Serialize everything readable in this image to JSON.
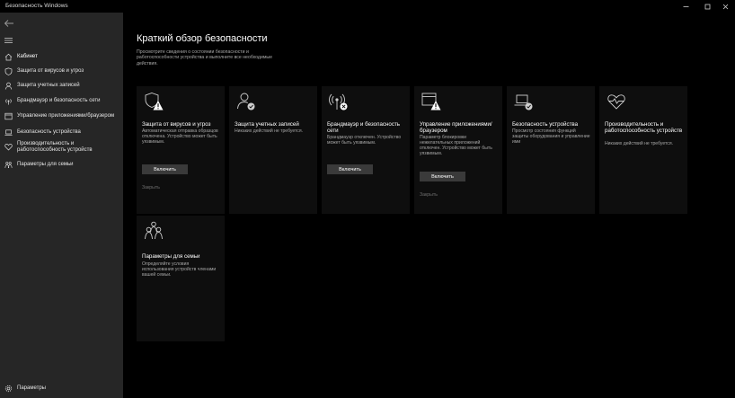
{
  "window": {
    "title": "Безопасность Windows"
  },
  "sidebar": {
    "items": [
      {
        "label": "Кабинет",
        "icon": "home-icon"
      },
      {
        "label": "Защита от вирусов и угроз",
        "icon": "shield-icon"
      },
      {
        "label": "Защита учетных записей",
        "icon": "person-icon"
      },
      {
        "label": "Брандмауэр и безопасность сети",
        "icon": "network-icon"
      },
      {
        "label": "Управление приложениями/браузером",
        "icon": "browser-icon"
      },
      {
        "label": "Безопасность устройства",
        "icon": "laptop-icon"
      },
      {
        "label": "Производительность и работоспособность устройств",
        "icon": "heart-icon"
      },
      {
        "label": "Параметры для семьи",
        "icon": "family-icon"
      }
    ],
    "settings_label": "Параметры"
  },
  "main": {
    "title": "Краткий обзор безопасности",
    "description": "Просмотрите сведения о состоянии безопасности и работоспособности устройства и выполните все необходимые действия."
  },
  "cards": [
    {
      "title": "Защита от вирусов и угроз",
      "description": "Автоматическая отправка образцов отключена. Устройство может быть уязвимым.",
      "button": "Включить",
      "link": "Закрыть",
      "status": "warning"
    },
    {
      "title": "Защита учетных записей",
      "description": "Никаких действий не требуется.",
      "status": "ok"
    },
    {
      "title": "Брандмауэр и безопасность сети",
      "description": "Брандмауэр отключен. Устройство может быть уязвимым.",
      "button": "Включить",
      "status": "error"
    },
    {
      "title": "Управление приложениями/браузером",
      "description": "Параметр блокировки нежелательных приложений отключен. Устройство может быть уязвимым.",
      "button": "Включить",
      "link": "Закрыть",
      "status": "warning"
    },
    {
      "title": "Безопасность устройства",
      "description": "Просмотр состояния функций защиты оборудования и управление ими",
      "status": "ok"
    },
    {
      "title": "Производительность и работоспособность устройств",
      "description": "Никаких действий не требуется.",
      "status": "none"
    },
    {
      "title": "Параметры для семьи",
      "description": "Определяйте условия использования устройств членами вашей семьи.",
      "status": "none"
    }
  ],
  "colors": {
    "sidebar_bg": "#262626",
    "card_bg": "#0e0e0e",
    "button_bg": "#3a3a3a",
    "warning": "#ffffff",
    "ok_badge": "#cfcfcf"
  }
}
